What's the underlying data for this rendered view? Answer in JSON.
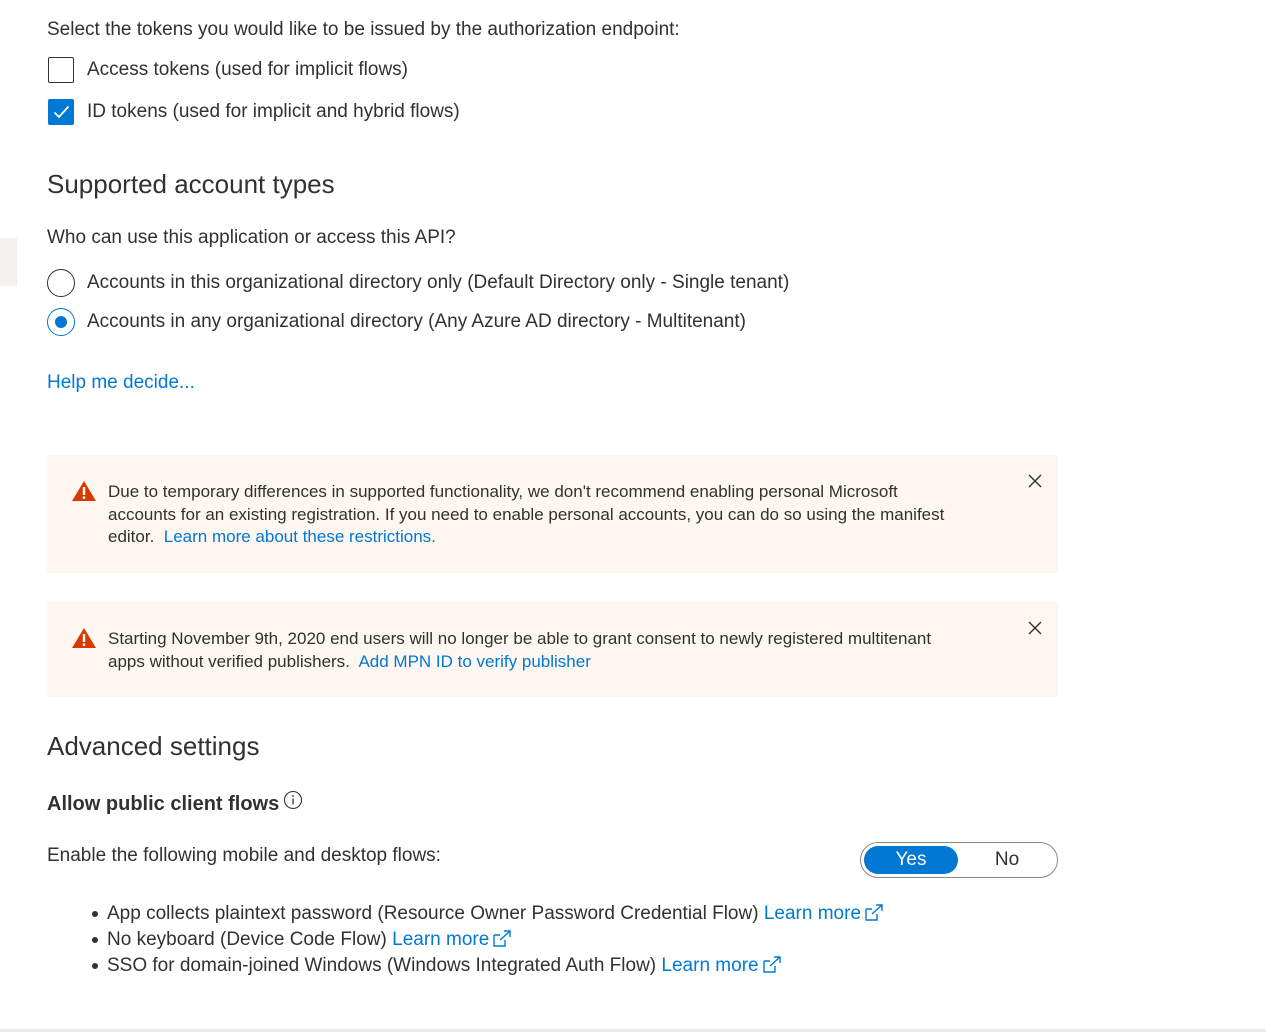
{
  "tokens": {
    "prompt": "Select the tokens you would like to be issued by the authorization endpoint:",
    "access_tokens": {
      "label": "Access tokens (used for implicit flows)",
      "checked": false
    },
    "id_tokens": {
      "label": "ID tokens (used for implicit and hybrid flows)",
      "checked": true
    }
  },
  "account_types": {
    "heading": "Supported account types",
    "question": "Who can use this application or access this API?",
    "options": [
      {
        "label": "Accounts in this organizational directory only (Default Directory only - Single tenant)",
        "selected": false
      },
      {
        "label": "Accounts in any organizational directory (Any Azure AD directory - Multitenant)",
        "selected": true
      }
    ],
    "help_link": "Help me decide..."
  },
  "banners": [
    {
      "icon": "warning-icon",
      "line1": "Due to temporary differences in supported functionality, we don't recommend enabling personal Microsoft",
      "line2": "accounts for an existing registration. If you need to enable personal accounts, you can do so using the manifest",
      "line3_text": "editor.",
      "link": "Learn more about these restrictions."
    },
    {
      "icon": "warning-icon",
      "line1": "Starting November 9th, 2020 end users will no longer be able to grant consent to newly registered multitenant",
      "line2_text": "apps without verified publishers.",
      "link": "Add MPN ID to verify publisher"
    }
  ],
  "advanced": {
    "heading": "Advanced settings",
    "public_client_label": "Allow public client flows",
    "enable_label": "Enable the following mobile and desktop flows:",
    "toggle": {
      "yes": "Yes",
      "no": "No",
      "selected": "Yes"
    },
    "flows": [
      {
        "text": "App collects plaintext password (Resource Owner Password Credential Flow)",
        "link": "Learn more"
      },
      {
        "text": "No keyboard (Device Code Flow)",
        "link": "Learn more"
      },
      {
        "text": "SSO for domain-joined Windows (Windows Integrated Auth Flow)",
        "link": "Learn more"
      }
    ]
  },
  "colors": {
    "accent": "#0078d4",
    "warning": "#d83b01",
    "banner_bg": "#fdf6f1",
    "text": "#323130"
  }
}
